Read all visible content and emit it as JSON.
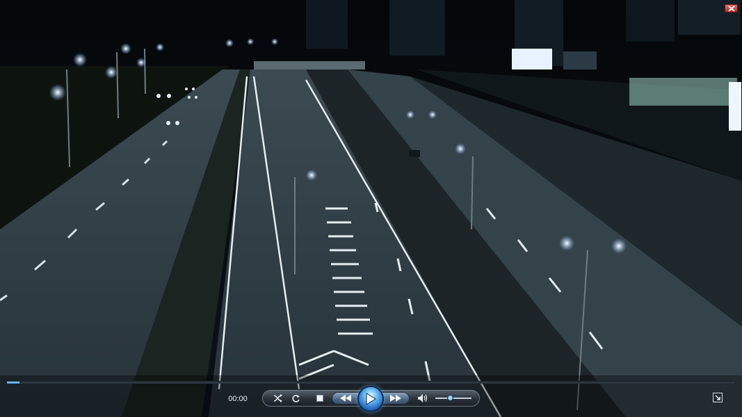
{
  "player": {
    "current_time": "00:00",
    "progress": 0.017,
    "volume": 0.42,
    "state": "paused"
  },
  "icons": {
    "close": "close-icon",
    "shuffle": "shuffle-icon",
    "repeat": "repeat-icon",
    "stop": "stop-icon",
    "previous": "previous-icon",
    "play": "play-icon",
    "next": "next-icon",
    "mute": "speaker-icon",
    "switch_to_library": "switch-to-library-icon"
  },
  "colors": {
    "accent": "#3b8fd6",
    "close": "#c8352a",
    "controls_bg": "#2a3038"
  }
}
